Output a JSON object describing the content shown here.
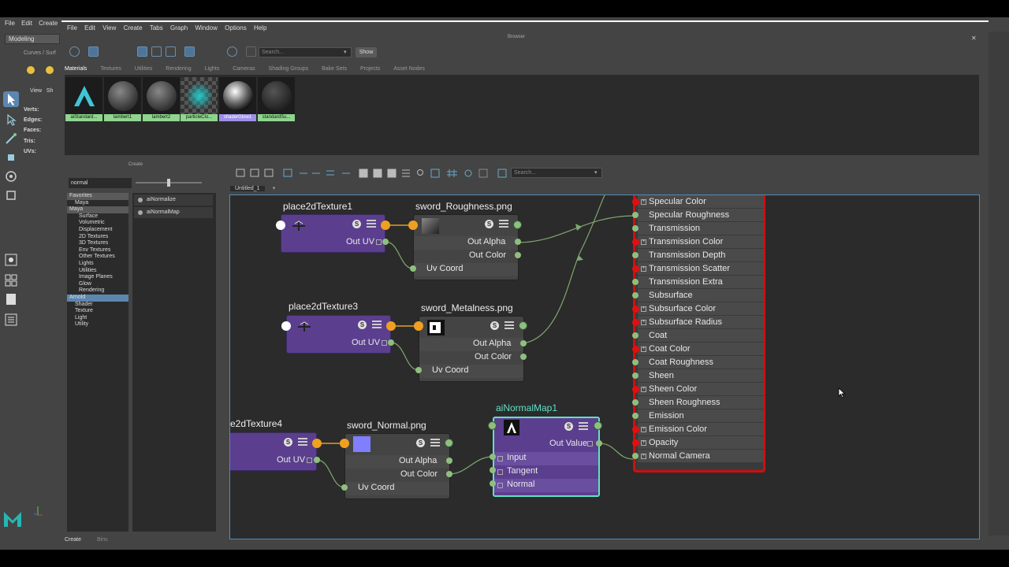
{
  "maya": {
    "menu": [
      "File",
      "Edit",
      "Create"
    ],
    "mode": "Modeling",
    "shelf_tab": "Curves / Surf",
    "viewport_menu": [
      "View",
      "Sh"
    ],
    "stats": [
      "Verts:",
      "Edges:",
      "Faces:",
      "Tris:",
      "UVs:"
    ]
  },
  "hypershade": {
    "menu": [
      "File",
      "Edit",
      "View",
      "Create",
      "Tabs",
      "Graph",
      "Window",
      "Options",
      "Help"
    ],
    "browser_label": "Browser",
    "search_placeholder": "Search...",
    "show_label": "Show",
    "browser_tabs": [
      "Materials",
      "Textures",
      "Utilities",
      "Rendering",
      "Lights",
      "Cameras",
      "Shading Groups",
      "Bake Sets",
      "Projects",
      "Asset Nodes"
    ],
    "swatches": [
      {
        "name": "aiStandard..."
      },
      {
        "name": "lambert1"
      },
      {
        "name": "lambert2"
      },
      {
        "name": "particleClo..."
      },
      {
        "name": "shaderGlow1"
      },
      {
        "name": "standardSu..."
      }
    ]
  },
  "create_panel": {
    "title": "Create",
    "search_value": "normal",
    "tree": [
      {
        "label": "Favorites",
        "kind": "cat"
      },
      {
        "label": "Maya",
        "kind": "sub2"
      },
      {
        "label": "Maya",
        "kind": "cat"
      },
      {
        "label": "Surface",
        "kind": "sub"
      },
      {
        "label": "Volumetric",
        "kind": "sub"
      },
      {
        "label": "Displacement",
        "kind": "sub"
      },
      {
        "label": "2D Textures",
        "kind": "sub"
      },
      {
        "label": "3D Textures",
        "kind": "sub"
      },
      {
        "label": "Env Textures",
        "kind": "sub"
      },
      {
        "label": "Other Textures",
        "kind": "sub"
      },
      {
        "label": "Lights",
        "kind": "sub"
      },
      {
        "label": "Utilities",
        "kind": "sub"
      },
      {
        "label": "Image Planes",
        "kind": "sub"
      },
      {
        "label": "Glow",
        "kind": "sub"
      },
      {
        "label": "Rendering",
        "kind": "sub"
      },
      {
        "label": "Arnold",
        "kind": "sel"
      },
      {
        "label": "Shader",
        "kind": "sub2"
      },
      {
        "label": "Texture",
        "kind": "sub2"
      },
      {
        "label": "Light",
        "kind": "sub2"
      },
      {
        "label": "Utility",
        "kind": "sub2"
      }
    ],
    "results": [
      "aiNormalize",
      "aiNormalMap"
    ],
    "bottom_tabs": [
      "Create",
      "Bins"
    ]
  },
  "graph": {
    "tab": "Untitled_1",
    "add_tab": "+",
    "search_placeholder": "Search...",
    "nodes": {
      "place1": {
        "title": "place2dTexture1",
        "out": "Out UV"
      },
      "rough": {
        "title": "sword_Roughness.png",
        "out_alpha": "Out Alpha",
        "out_color": "Out Color",
        "uv": "Uv Coord"
      },
      "place3": {
        "title": "place2dTexture3",
        "out": "Out UV"
      },
      "metal": {
        "title": "sword_Metalness.png",
        "out_alpha": "Out Alpha",
        "out_color": "Out Color",
        "uv": "Uv Coord"
      },
      "place4": {
        "title": "e2dTexture4",
        "out": "Out UV"
      },
      "normal": {
        "title": "sword_Normal.png",
        "out_alpha": "Out Alpha",
        "out_color": "Out Color",
        "uv": "Uv Coord"
      },
      "nmap": {
        "title": "aiNormalMap1",
        "out": "Out Value",
        "inputs": [
          "Input",
          "Tangent",
          "Normal"
        ]
      }
    },
    "material_attrs": [
      {
        "label": "Specular Color",
        "port": "red",
        "exp": true
      },
      {
        "label": "Specular Roughness",
        "port": "green",
        "exp": false
      },
      {
        "label": "Transmission",
        "port": "green",
        "exp": false
      },
      {
        "label": "Transmission Color",
        "port": "red",
        "exp": true
      },
      {
        "label": "Transmission Depth",
        "port": "green",
        "exp": false
      },
      {
        "label": "Transmission Scatter",
        "port": "red",
        "exp": true
      },
      {
        "label": "Transmission Extra Roughness",
        "port": "green",
        "exp": false
      },
      {
        "label": "Subsurface",
        "port": "green",
        "exp": false
      },
      {
        "label": "Subsurface Color",
        "port": "red",
        "exp": true
      },
      {
        "label": "Subsurface Radius",
        "port": "red",
        "exp": true
      },
      {
        "label": "Coat",
        "port": "green",
        "exp": false
      },
      {
        "label": "Coat Color",
        "port": "red",
        "exp": true
      },
      {
        "label": "Coat Roughness",
        "port": "green",
        "exp": false
      },
      {
        "label": "Sheen",
        "port": "green",
        "exp": false
      },
      {
        "label": "Sheen Color",
        "port": "red",
        "exp": true
      },
      {
        "label": "Sheen Roughness",
        "port": "green",
        "exp": false
      },
      {
        "label": "Emission",
        "port": "green",
        "exp": false
      },
      {
        "label": "Emission Color",
        "port": "red",
        "exp": true
      },
      {
        "label": "Opacity",
        "port": "red",
        "exp": true
      },
      {
        "label": "Normal Camera",
        "port": "green",
        "exp": true
      }
    ]
  },
  "colors": {
    "accent": "#5b86b0",
    "node_purple": "#5b3f8e",
    "port_orange": "#f0a020",
    "port_green": "#8fbf7f",
    "port_red": "#e01010",
    "selection_teal": "#61e0c6",
    "material_border": "#cc1010"
  }
}
